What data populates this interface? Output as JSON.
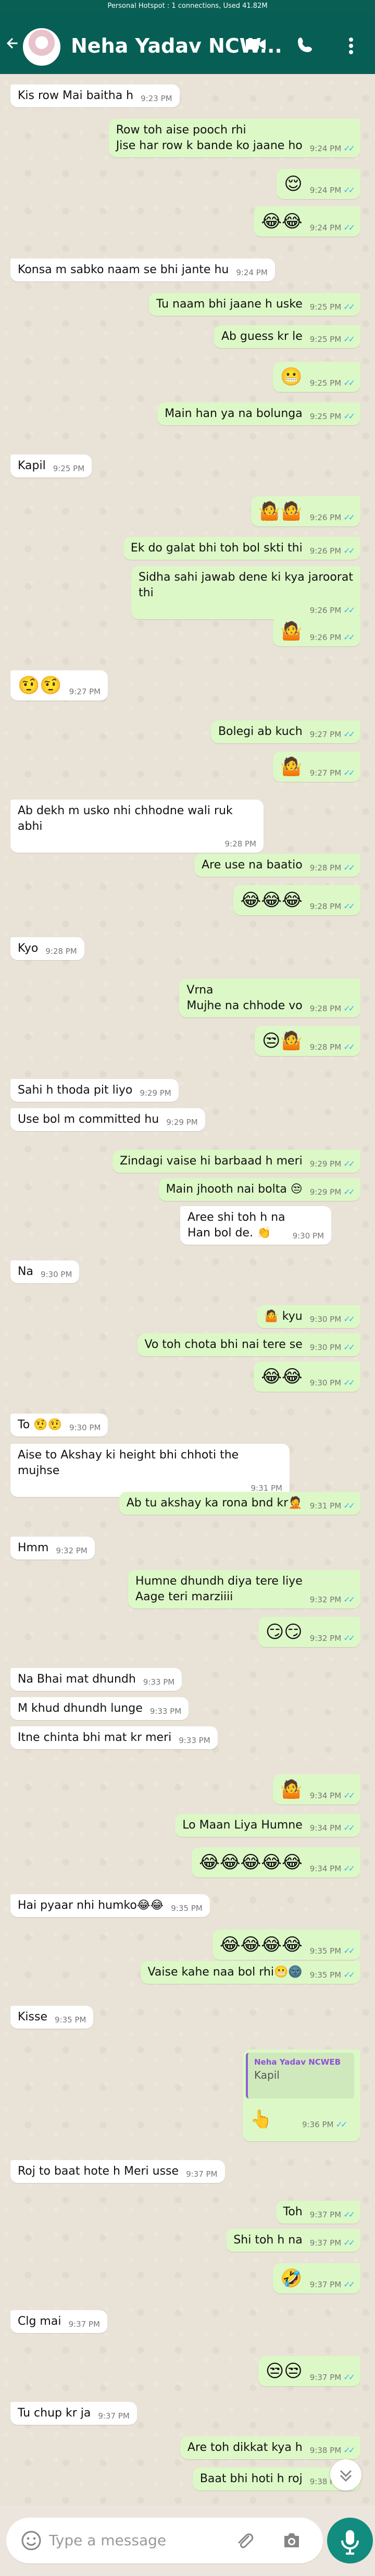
{
  "status": {
    "hotspot": "Personal Hotspot : 1 connections, Used 41.82M"
  },
  "header": {
    "contact_name": "Neha Yadav NCW..."
  },
  "icons": {
    "back": "arrow-back-icon",
    "video": "video-call-icon",
    "call": "phone-icon",
    "menu": "more-vert-icon",
    "emoji": "emoji-icon",
    "attach": "attach-icon",
    "camera": "camera-icon",
    "mic": "mic-icon",
    "scroll": "chevron-down-icon"
  },
  "colors": {
    "appbar": "#075e54",
    "incoming": "#ffffff",
    "outgoing": "#dcf8c6",
    "read_ticks": "#34b7f1",
    "mic": "#128c7e"
  },
  "input": {
    "placeholder": "Type a message"
  },
  "messages": [
    {
      "text": "Kis row Mai baitha h",
      "time": "9:23 PM",
      "dir": "in"
    },
    {
      "text": "Row toh aise pooch rhi\nJise har row k bande ko jaane ho",
      "time": "9:24 PM",
      "dir": "out"
    },
    {
      "text": "😌",
      "time": "9:24 PM",
      "dir": "out"
    },
    {
      "text": "😂😂",
      "time": "9:24 PM",
      "dir": "out"
    },
    {
      "text": "Konsa m sabko naam se bhi jante hu",
      "time": "9:24 PM",
      "dir": "in"
    },
    {
      "text": "Tu naam bhi jaane h uske",
      "time": "9:25 PM",
      "dir": "out"
    },
    {
      "text": "Ab guess kr le",
      "time": "9:25 PM",
      "dir": "out"
    },
    {
      "text": "😬",
      "time": "9:25 PM",
      "dir": "out"
    },
    {
      "text": "Main han ya na bolunga",
      "time": "9:25 PM",
      "dir": "out"
    },
    {
      "text": "Kapil",
      "time": "9:25 PM",
      "dir": "in"
    },
    {
      "text": "🤷🤷",
      "time": "9:26 PM",
      "dir": "out"
    },
    {
      "text": "Ek do galat bhi toh bol skti thi",
      "time": "9:26 PM",
      "dir": "out"
    },
    {
      "text": "Sidha sahi jawab dene ki kya jaroorat thi",
      "time": "9:26 PM",
      "dir": "out"
    },
    {
      "text": "🤷",
      "time": "9:26 PM",
      "dir": "out"
    },
    {
      "text": "🤨🤨",
      "time": "9:27 PM",
      "dir": "in"
    },
    {
      "text": "Bolegi ab kuch",
      "time": "9:27 PM",
      "dir": "out"
    },
    {
      "text": "🤷",
      "time": "9:27 PM",
      "dir": "out"
    },
    {
      "text": "Ab dekh m usko nhi chhodne wali ruk abhi",
      "time": "9:28 PM",
      "dir": "in"
    },
    {
      "text": "Are use na baatio",
      "time": "9:28 PM",
      "dir": "out"
    },
    {
      "text": "😂😂😂",
      "time": "9:28 PM",
      "dir": "out"
    },
    {
      "text": "Kyo",
      "time": "9:28 PM",
      "dir": "in"
    },
    {
      "text": "Vrna\nMujhe na chhode vo",
      "time": "9:28 PM",
      "dir": "out"
    },
    {
      "text": "😒🤷",
      "time": "9:28 PM",
      "dir": "out"
    },
    {
      "text": "Sahi h thoda pit liyo",
      "time": "9:29 PM",
      "dir": "in"
    },
    {
      "text": "Use bol m committed hu",
      "time": "9:29 PM",
      "dir": "in"
    },
    {
      "text": "Zindagi vaise hi barbaad h meri",
      "time": "9:29 PM",
      "dir": "out"
    },
    {
      "text": "Main jhooth nai bolta 😒",
      "time": "9:29 PM",
      "dir": "out"
    },
    {
      "text": "Aree shi toh h na\nHan bol de. 👏",
      "time": "9:30 PM",
      "dir": "in"
    },
    {
      "text": "Na",
      "time": "9:30 PM",
      "dir": "in"
    },
    {
      "text": "🤷 kyu",
      "time": "9:30 PM",
      "dir": "out"
    },
    {
      "text": "Vo toh chota bhi nai tere se",
      "time": "9:30 PM",
      "dir": "out"
    },
    {
      "text": "😂😂",
      "time": "9:30 PM",
      "dir": "out"
    },
    {
      "text": "To 🤨🤨",
      "time": "9:30 PM",
      "dir": "in"
    },
    {
      "text": "Aise to Akshay ki height bhi chhoti the mujhse",
      "time": "9:31 PM",
      "dir": "in"
    },
    {
      "text": "Ab tu akshay ka rona bnd kr🤦",
      "time": "9:31 PM",
      "dir": "out"
    },
    {
      "text": "Hmm",
      "time": "9:32 PM",
      "dir": "in"
    },
    {
      "text": "Humne dhundh diya tere liye\nAage teri marziiii",
      "time": "9:32 PM",
      "dir": "out"
    },
    {
      "text": "😏😏",
      "time": "9:32 PM",
      "dir": "out"
    },
    {
      "text": "Na Bhai mat dhundh",
      "time": "9:33 PM",
      "dir": "in"
    },
    {
      "text": "M khud dhundh lunge",
      "time": "9:33 PM",
      "dir": "in"
    },
    {
      "text": "Itne chinta bhi mat kr meri",
      "time": "9:33 PM",
      "dir": "in"
    },
    {
      "text": "🤷",
      "time": "9:34 PM",
      "dir": "out"
    },
    {
      "text": "Lo Maan Liya Humne",
      "time": "9:34 PM",
      "dir": "out"
    },
    {
      "text": "😂😂😂😂😂",
      "time": "9:34 PM",
      "dir": "out"
    },
    {
      "text": "Hai pyaar nhi humko😂😂",
      "time": "9:35 PM",
      "dir": "in"
    },
    {
      "text": "😂😂😂😂",
      "time": "9:35 PM",
      "dir": "out"
    },
    {
      "text": "Vaise kahe naa bol rhi😬🌚",
      "time": "9:35 PM",
      "dir": "out"
    },
    {
      "text": "Kisse",
      "time": "9:35 PM",
      "dir": "in"
    },
    {
      "text": "👆",
      "time": "9:36 PM",
      "dir": "out",
      "quote": {
        "name": "Neha Yadav NCWEB",
        "text": "Kapil"
      }
    },
    {
      "text": "Roj to baat hote h Meri usse",
      "time": "9:37 PM",
      "dir": "in"
    },
    {
      "text": "Toh",
      "time": "9:37 PM",
      "dir": "out"
    },
    {
      "text": "Shi toh h na",
      "time": "9:37 PM",
      "dir": "out"
    },
    {
      "text": "🤣",
      "time": "9:37 PM",
      "dir": "out"
    },
    {
      "text": "Clg mai",
      "time": "9:37 PM",
      "dir": "in"
    },
    {
      "text": "😒😒",
      "time": "9:37 PM",
      "dir": "out"
    },
    {
      "text": "Tu chup kr ja",
      "time": "9:37 PM",
      "dir": "in"
    },
    {
      "text": "Are toh dikkat kya h",
      "time": "9:38 PM",
      "dir": "out"
    },
    {
      "text": "Baat bhi hoti h roj",
      "time": "9:38 PM",
      "dir": "out"
    }
  ]
}
